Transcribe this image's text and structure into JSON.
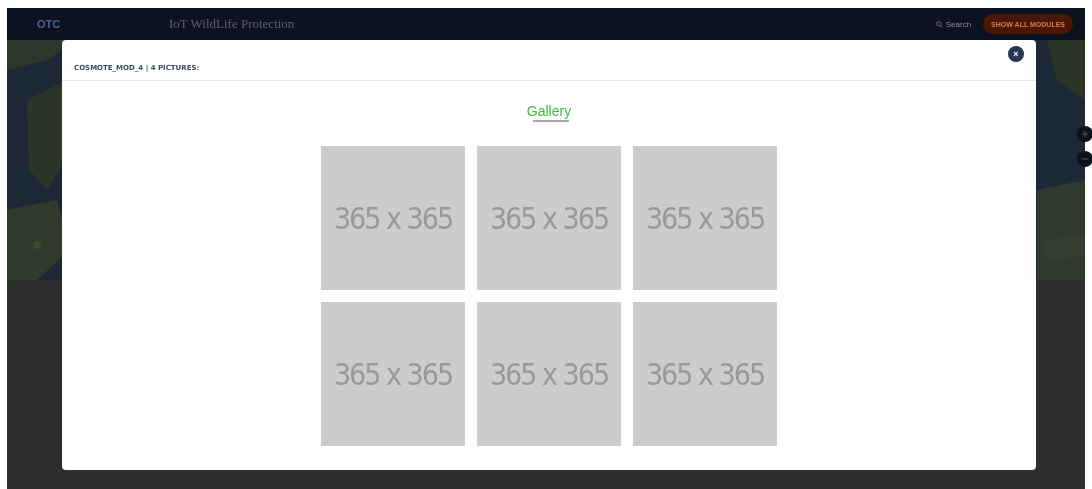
{
  "topbar": {
    "logo": "OTC",
    "title": "IoT WildLife Protection",
    "search": "Search",
    "modules_button": "SHOW ALL MODULES"
  },
  "modal": {
    "header": "COSMOTE_MOD_4 | 4 PICTURES:",
    "close": "×",
    "gallery_title": "Gallery",
    "tiles": [
      {
        "label": "365 x 365"
      },
      {
        "label": "365 x 365"
      },
      {
        "label": "365 x 365"
      },
      {
        "label": "365 x 365"
      },
      {
        "label": "365 x 365"
      },
      {
        "label": "365 x 365"
      }
    ]
  }
}
